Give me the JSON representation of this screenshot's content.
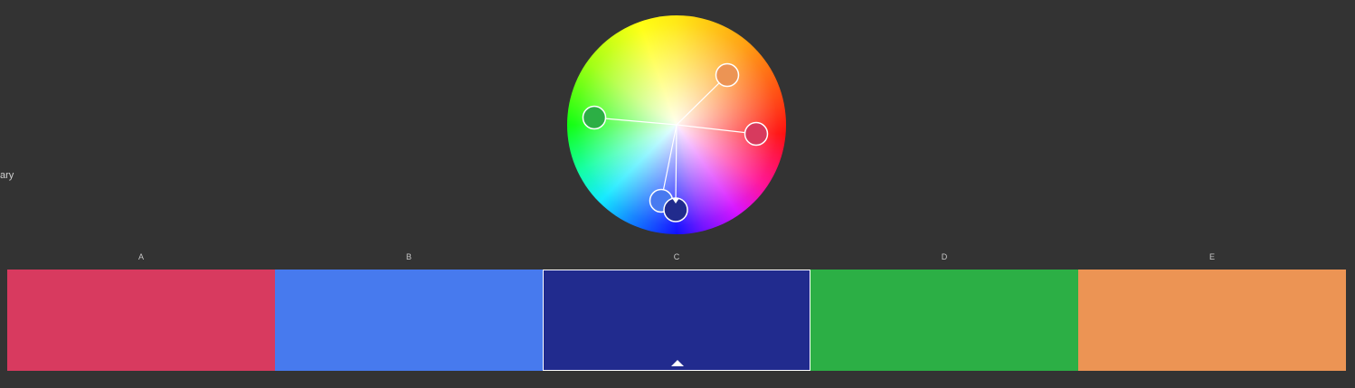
{
  "sidebar": {
    "partial_label": "ary"
  },
  "wheel": {
    "base_handle": "C",
    "handles": [
      {
        "swatch": "A",
        "color": "#d73a5e"
      },
      {
        "swatch": "B",
        "color": "#487af0"
      },
      {
        "swatch": "C",
        "color": "#212b8d"
      },
      {
        "swatch": "D",
        "color": "#2caf45"
      },
      {
        "swatch": "E",
        "color": "#ec9454"
      }
    ]
  },
  "swatches": [
    {
      "label": "A",
      "color": "#d83a5f"
    },
    {
      "label": "B",
      "color": "#477aee"
    },
    {
      "label": "C",
      "color": "#212b8e",
      "selected": true,
      "base": true
    },
    {
      "label": "D",
      "color": "#2caf45"
    },
    {
      "label": "E",
      "color": "#ec9454"
    }
  ]
}
